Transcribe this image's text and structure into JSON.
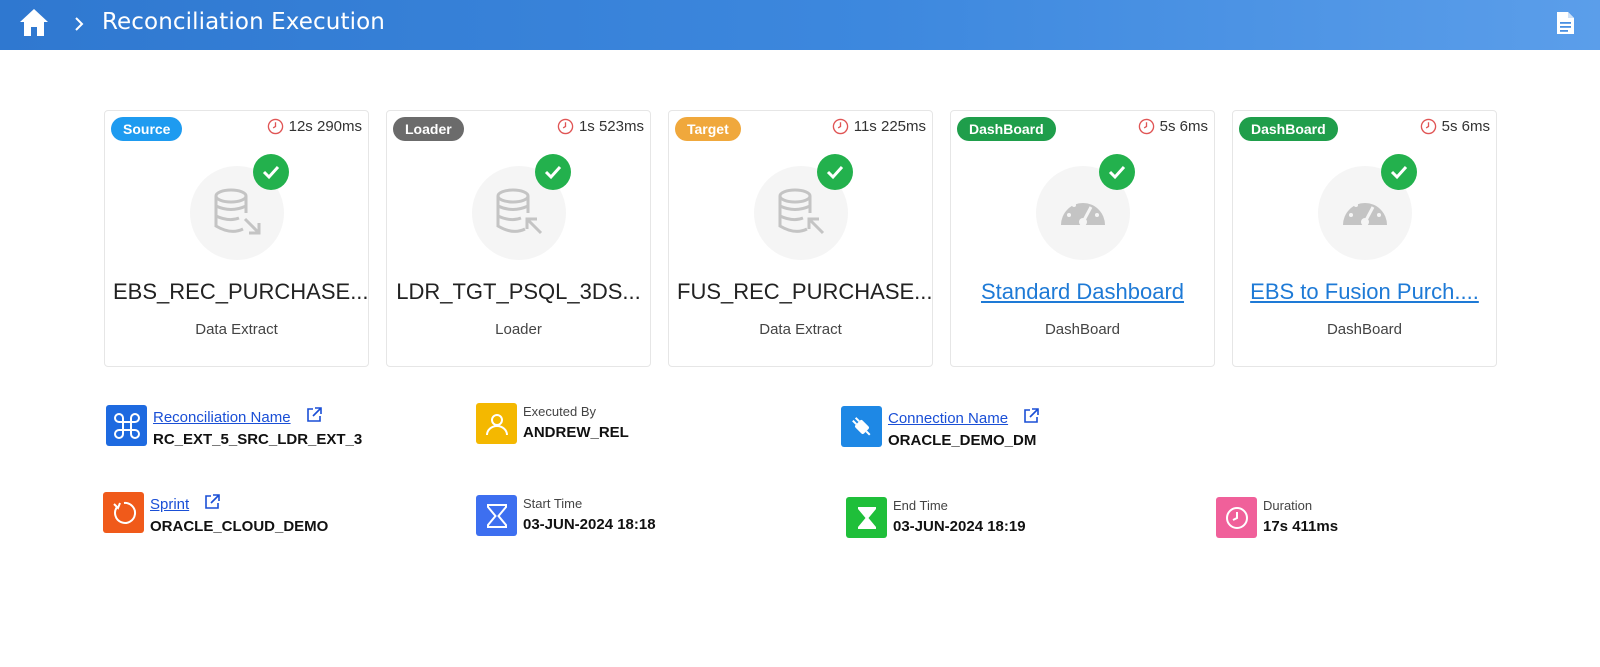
{
  "header": {
    "title": "Reconciliation Execution",
    "home_icon": "home-icon",
    "separator_icon": "chevron-right-icon",
    "doc_icon": "document-icon"
  },
  "colors": {
    "header_start": "#2f78d0",
    "header_end": "#5b9eea",
    "success": "#23b14d",
    "source": "#1e9bf0",
    "loader": "#6b6b6b",
    "target": "#f0a83c",
    "dashboard": "#1f9e4b"
  },
  "cards": [
    {
      "badge": "Source",
      "time": "12s 290ms",
      "name": "EBS_REC_PURCHASE...",
      "type": "Data Extract",
      "icon": "database-export-icon"
    },
    {
      "badge": "Loader",
      "time": "1s 523ms",
      "name": "LDR_TGT_PSQL_3DS...",
      "type": "Loader",
      "icon": "database-import-icon"
    },
    {
      "badge": "Target",
      "time": "11s 225ms",
      "name": "FUS_REC_PURCHASE...",
      "type": "Data Extract",
      "icon": "database-import-icon"
    },
    {
      "badge": "DashBoard",
      "time": "5s 6ms",
      "name": "Standard Dashboard",
      "type": "DashBoard",
      "icon": "gauge-icon"
    },
    {
      "badge": "DashBoard",
      "time": "5s 6ms",
      "name": "EBS to Fusion Purch....",
      "type": "DashBoard",
      "icon": "gauge-icon"
    }
  ],
  "info": {
    "reconciliation": {
      "label": "Reconciliation Name",
      "value": "RC_EXT_5_SRC_LDR_EXT_3"
    },
    "executed_by": {
      "label": "Executed By",
      "value": "ANDREW_REL"
    },
    "connection": {
      "label": "Connection Name",
      "value": "ORACLE_DEMO_DM"
    },
    "sprint": {
      "label": "Sprint",
      "value": "ORACLE_CLOUD_DEMO"
    },
    "start_time": {
      "label": "Start Time",
      "value": "03-JUN-2024 18:18"
    },
    "end_time": {
      "label": "End Time",
      "value": "03-JUN-2024 18:19"
    },
    "duration": {
      "label": "Duration",
      "value": "17s 411ms"
    }
  }
}
